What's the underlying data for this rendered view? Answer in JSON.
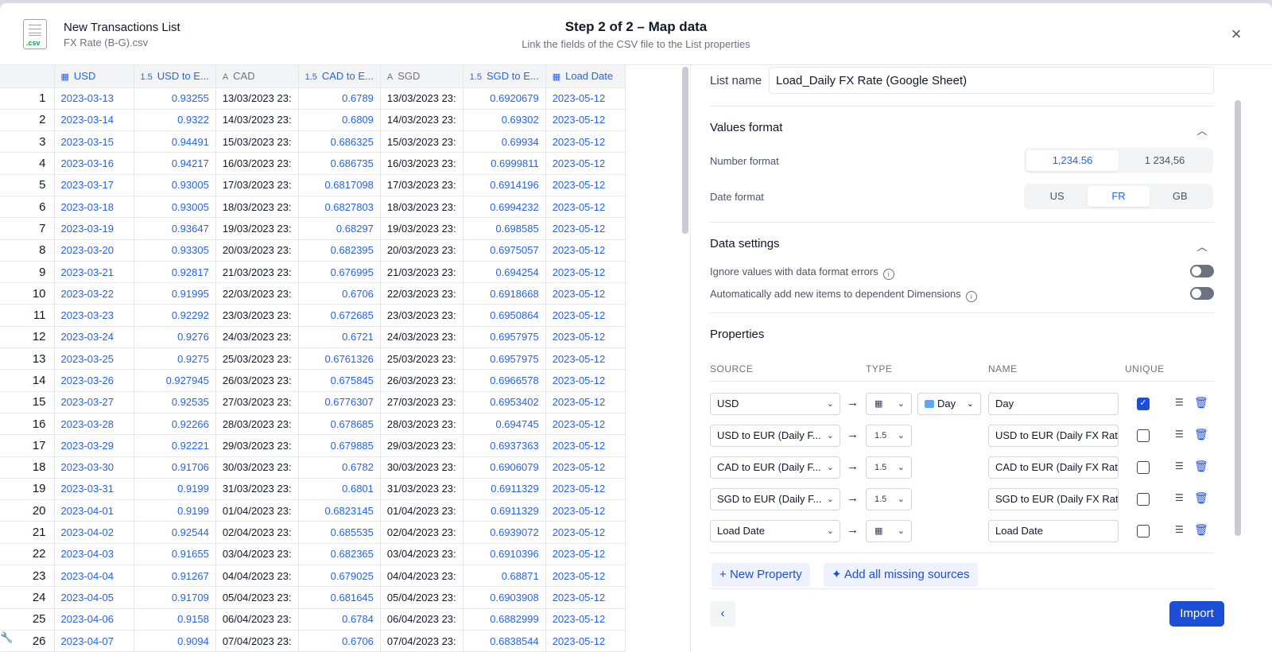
{
  "header": {
    "file_title": "New Transactions List",
    "file_name": "FX Rate (B-G).csv",
    "file_ext": ".csv",
    "step": "Step 2 of 2 – Map data",
    "description": "Link the fields of the CSV file to the List properties"
  },
  "table": {
    "columns": [
      {
        "label": "USD",
        "icon": "calendar-icon"
      },
      {
        "label": "USD to E...",
        "icon": "number-icon"
      },
      {
        "label": "CAD",
        "icon": "text-icon"
      },
      {
        "label": "CAD to E...",
        "icon": "number-icon"
      },
      {
        "label": "SGD",
        "icon": "text-icon"
      },
      {
        "label": "SGD to E...",
        "icon": "number-icon"
      },
      {
        "label": "Load Date",
        "icon": "calendar-icon"
      }
    ],
    "rows": [
      [
        "1",
        "2023-03-13",
        "0.93255",
        "13/03/2023 23:",
        "0.6789",
        "13/03/2023 23:",
        "0.6920679",
        "2023-05-12"
      ],
      [
        "2",
        "2023-03-14",
        "0.9322",
        "14/03/2023 23:",
        "0.6809",
        "14/03/2023 23:",
        "0.69302",
        "2023-05-12"
      ],
      [
        "3",
        "2023-03-15",
        "0.94491",
        "15/03/2023 23:",
        "0.686325",
        "15/03/2023 23:",
        "0.69934",
        "2023-05-12"
      ],
      [
        "4",
        "2023-03-16",
        "0.94217",
        "16/03/2023 23:",
        "0.686735",
        "16/03/2023 23:",
        "0.6999811",
        "2023-05-12"
      ],
      [
        "5",
        "2023-03-17",
        "0.93005",
        "17/03/2023 23:",
        "0.6817098",
        "17/03/2023 23:",
        "0.6914196",
        "2023-05-12"
      ],
      [
        "6",
        "2023-03-18",
        "0.93005",
        "18/03/2023 23:",
        "0.6827803",
        "18/03/2023 23:",
        "0.6994232",
        "2023-05-12"
      ],
      [
        "7",
        "2023-03-19",
        "0.93647",
        "19/03/2023 23:",
        "0.68297",
        "19/03/2023 23:",
        "0.698585",
        "2023-05-12"
      ],
      [
        "8",
        "2023-03-20",
        "0.93305",
        "20/03/2023 23:",
        "0.682395",
        "20/03/2023 23:",
        "0.6975057",
        "2023-05-12"
      ],
      [
        "9",
        "2023-03-21",
        "0.92817",
        "21/03/2023 23:",
        "0.676995",
        "21/03/2023 23:",
        "0.694254",
        "2023-05-12"
      ],
      [
        "10",
        "2023-03-22",
        "0.91995",
        "22/03/2023 23:",
        "0.6706",
        "22/03/2023 23:",
        "0.6918668",
        "2023-05-12"
      ],
      [
        "11",
        "2023-03-23",
        "0.92292",
        "23/03/2023 23:",
        "0.672685",
        "23/03/2023 23:",
        "0.6950864",
        "2023-05-12"
      ],
      [
        "12",
        "2023-03-24",
        "0.9276",
        "24/03/2023 23:",
        "0.6721",
        "24/03/2023 23:",
        "0.6957975",
        "2023-05-12"
      ],
      [
        "13",
        "2023-03-25",
        "0.9275",
        "25/03/2023 23:",
        "0.6761326",
        "25/03/2023 23:",
        "0.6957975",
        "2023-05-12"
      ],
      [
        "14",
        "2023-03-26",
        "0.927945",
        "26/03/2023 23:",
        "0.675845",
        "26/03/2023 23:",
        "0.6966578",
        "2023-05-12"
      ],
      [
        "15",
        "2023-03-27",
        "0.92535",
        "27/03/2023 23:",
        "0.6776307",
        "27/03/2023 23:",
        "0.6953402",
        "2023-05-12"
      ],
      [
        "16",
        "2023-03-28",
        "0.92266",
        "28/03/2023 23:",
        "0.678685",
        "28/03/2023 23:",
        "0.694745",
        "2023-05-12"
      ],
      [
        "17",
        "2023-03-29",
        "0.92221",
        "29/03/2023 23:",
        "0.679885",
        "29/03/2023 23:",
        "0.6937363",
        "2023-05-12"
      ],
      [
        "18",
        "2023-03-30",
        "0.91706",
        "30/03/2023 23:",
        "0.6782",
        "30/03/2023 23:",
        "0.6906079",
        "2023-05-12"
      ],
      [
        "19",
        "2023-03-31",
        "0.9199",
        "31/03/2023 23:",
        "0.6801",
        "31/03/2023 23:",
        "0.6911329",
        "2023-05-12"
      ],
      [
        "20",
        "2023-04-01",
        "0.9199",
        "01/04/2023 23:",
        "0.6823145",
        "01/04/2023 23:",
        "0.6911329",
        "2023-05-12"
      ],
      [
        "21",
        "2023-04-02",
        "0.92544",
        "02/04/2023 23:",
        "0.685535",
        "02/04/2023 23:",
        "0.6939072",
        "2023-05-12"
      ],
      [
        "22",
        "2023-04-03",
        "0.91655",
        "03/04/2023 23:",
        "0.682365",
        "03/04/2023 23:",
        "0.6910396",
        "2023-05-12"
      ],
      [
        "23",
        "2023-04-04",
        "0.91267",
        "04/04/2023 23:",
        "0.679025",
        "04/04/2023 23:",
        "0.68871",
        "2023-05-12"
      ],
      [
        "24",
        "2023-04-05",
        "0.91709",
        "05/04/2023 23:",
        "0.681645",
        "05/04/2023 23:",
        "0.6903908",
        "2023-05-12"
      ],
      [
        "25",
        "2023-04-06",
        "0.9158",
        "06/04/2023 23:",
        "0.6784",
        "06/04/2023 23:",
        "0.6882999",
        "2023-05-12"
      ],
      [
        "26",
        "2023-04-07",
        "0.9094",
        "07/04/2023 23:",
        "0.6706",
        "07/04/2023 23:",
        "0.6838544",
        "2023-05-12"
      ]
    ]
  },
  "panel": {
    "list_name_label": "List name",
    "list_name_value": "Load_Daily FX Rate (Google Sheet)",
    "values_format": {
      "title": "Values format",
      "number_label": "Number format",
      "number_options": [
        "1,234.56",
        "1 234,56"
      ],
      "number_selected": 0,
      "date_label": "Date format",
      "date_options": [
        "US",
        "FR",
        "GB"
      ],
      "date_selected": 1
    },
    "data_settings": {
      "title": "Data settings",
      "ignore_errors_label": "Ignore values with data format errors",
      "ignore_errors_on": false,
      "auto_add_label": "Automatically add new items to dependent Dimensions",
      "auto_add_on": false
    },
    "properties": {
      "title": "Properties",
      "col_source": "SOURCE",
      "col_type": "TYPE",
      "col_name": "NAME",
      "col_unique": "UNIQUE",
      "rows": [
        {
          "source": "USD",
          "type": "calendar-grid-icon",
          "granularity": "Day",
          "name": "Day",
          "unique": true
        },
        {
          "source": "USD to EUR (Daily F...",
          "type": "1.5",
          "name": "USD to EUR (Daily FX Rate)",
          "unique": false
        },
        {
          "source": "CAD to EUR (Daily F...",
          "type": "1.5",
          "name": "CAD to EUR (Daily FX Rate)",
          "unique": false
        },
        {
          "source": "SGD to EUR (Daily F...",
          "type": "1.5",
          "name": "SGD to EUR (Daily FX Rate)",
          "unique": false
        },
        {
          "source": "Load Date",
          "type": "calendar-icon",
          "name": "Load Date",
          "unique": false
        }
      ],
      "new_property": "New Property",
      "add_missing": "Add all missing sources"
    }
  },
  "footer": {
    "import_label": "Import"
  },
  "colors": {
    "accent": "#1d4ed8",
    "link_blue": "#2563eb",
    "header_bg": "#f3f4f6"
  }
}
